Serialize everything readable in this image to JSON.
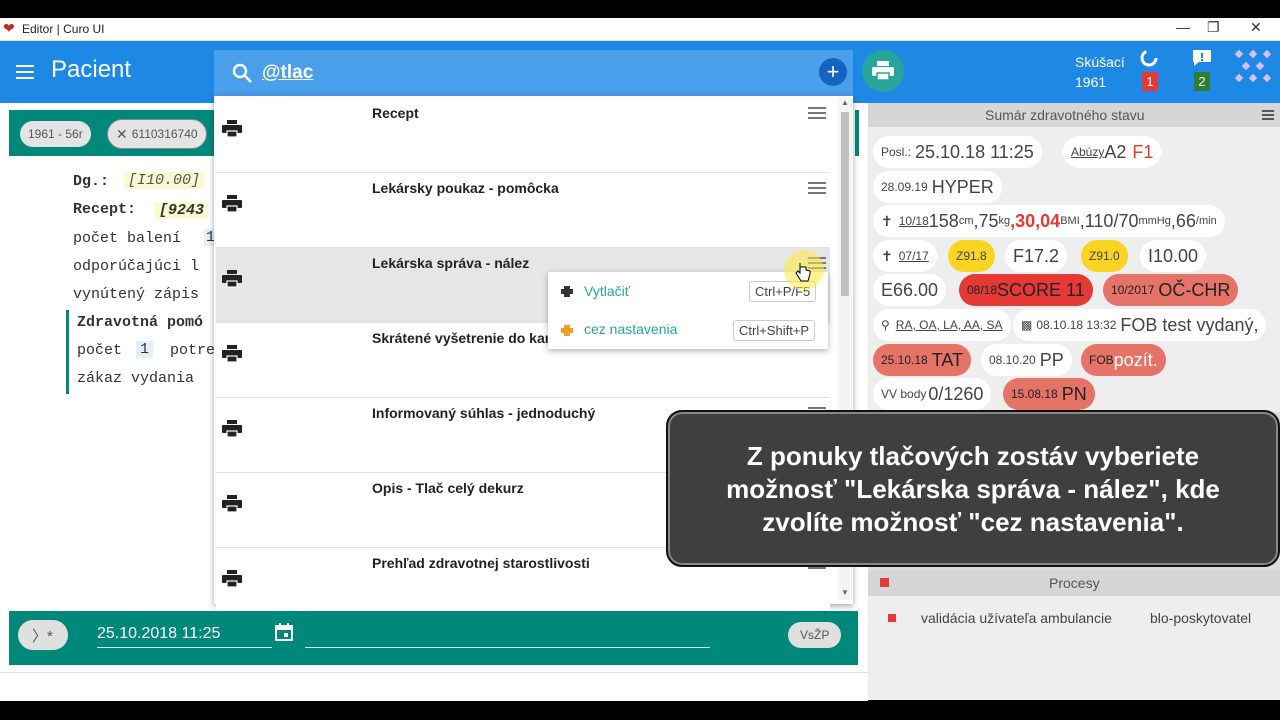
{
  "window": {
    "title": "Editor | Curo UI",
    "buttons": [
      "—",
      "❐",
      "✕"
    ]
  },
  "appbar": {
    "page_title": "Pacient",
    "search_value": "@tlac",
    "user_name": "Skúšací",
    "user_year": "1961",
    "badge_sync": "1",
    "badge_msg": "2"
  },
  "patient_chips": {
    "age": "1961 - 56r",
    "id": "6110316740"
  },
  "editor": {
    "dg_label": "Dg.:",
    "dg_value": "[I10.00]",
    "recept_label": "Recept:",
    "recept_value": "[9243",
    "line_count": "počet balení",
    "line_count_val": "1",
    "line_ref": "odporúčajúci l",
    "line_forced": "vynútený zápis",
    "block_title": "Zdravotná pomó",
    "block_count": "počet",
    "block_count_val": "1",
    "block_count_rest": "potre",
    "block_ban": "zákaz vydania"
  },
  "menu": {
    "items": [
      {
        "label": "Recept"
      },
      {
        "label": "Lekársky poukaz - pomôcka"
      },
      {
        "label": "Lekárska správa - nález"
      },
      {
        "label": "Skrátené vyšetrenie do karty"
      },
      {
        "label": "Informovaný súhlas - jednoduchý"
      },
      {
        "label": "Opis - Tlač celý dekurz"
      },
      {
        "label": "Prehľad zdravotnej starostlivosti"
      }
    ],
    "submenu": [
      {
        "label": "Vytlačiť",
        "shortcut": "Ctrl+P/F5"
      },
      {
        "label": "cez nastavenia",
        "shortcut": "Ctrl+Shift+P"
      }
    ]
  },
  "bottom": {
    "datetime": "25.10.2018 11:25",
    "vszp": "VsŽP"
  },
  "summary": {
    "title": "Sumár zdravotného stavu",
    "posl_label": "Posl.:",
    "posl_value": "25.10.18 11:25",
    "abuzy_label": "Abúzy",
    "abuzy_a": "A2",
    "abuzy_f": "F1",
    "hyper_date": "28.09.19",
    "hyper_label": "HYPER",
    "vitals": {
      "date": "10/18",
      "height": "158",
      "height_u": "cm",
      "weight": ",75",
      "weight_u": "kg",
      "bmi": ",30,04",
      "bmi_u": "BMI",
      "bp": ",110/70",
      "bp_u": "mmHg",
      "pulse": ",66",
      "pulse_u": "/min"
    },
    "dg_date": "07/17",
    "z918": "Z91.8",
    "f172": "F17.2",
    "z910": "Z91.0",
    "i1000": "I10.00",
    "e6600": "E66.00",
    "score_date": "08/18",
    "score": "SCORE 11",
    "oc_date": "10/2017",
    "oc": "OČ-CHR",
    "ra": "RA, OA, LA, AA, SA",
    "fob_date": "08.10.18 13:32",
    "fob": "FOB test vydaný,",
    "tat_date": "25.10.18",
    "tat": "TAT",
    "pp_date": "08.10.20",
    "pp": "PP",
    "fobpoz_small": "FOB",
    "fobpoz": "pozít.",
    "vv_label": "VV body",
    "vv": "0/1260",
    "pn_date": "15.08.18",
    "pn": "PN"
  },
  "procesy": {
    "title": "Procesy",
    "row_name": "validácia užívateľa ambulancie",
    "row_value": "blo-poskytovatel"
  },
  "tooltip": {
    "line1": "Z ponuky tlačových zostáv vyberiete",
    "line2": "možnosť \"Lekárska správa - nález\", kde",
    "line3": "zvolíte možnosť \"cez nastavenia\"."
  },
  "colors": {
    "appbar": "#1e88e5",
    "teal": "#00897b",
    "red_chip": "#e57368",
    "yellow_chip": "#f9d423",
    "tooltip_bg": "#3f3f3f"
  }
}
